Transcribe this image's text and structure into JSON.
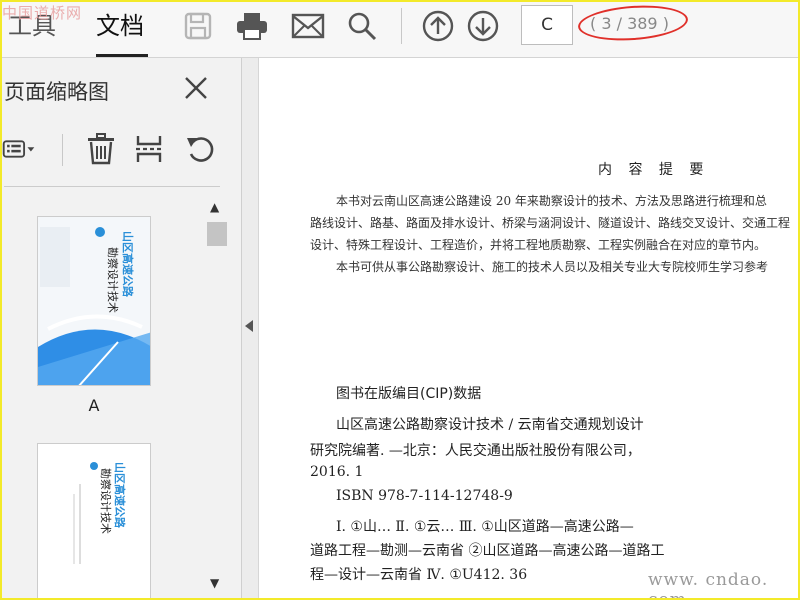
{
  "watermark": "中国道桥网",
  "toolbar": {
    "tabs": [
      "工具",
      "文档"
    ],
    "active_tab": "文档",
    "current_page": "C",
    "page_count": "( 3 / 389 )"
  },
  "sidebar": {
    "title": "页面缩略图",
    "thumbnails": [
      {
        "label": "A",
        "cover_title": "山区高速公路",
        "cover_subtitle": "勘察设计技术"
      },
      {
        "label": "",
        "cover_title": "山区高速公路",
        "cover_subtitle": "勘察设计技术"
      }
    ]
  },
  "document": {
    "summary_heading": "内  容  提  要",
    "summary_lines": [
      "本书对云南山区高速公路建设 20 年来勘察设计的技术、方法及思路进行梳理和总",
      "路线设计、路基、路面及排水设计、桥梁与涵洞设计、隧道设计、路线交叉设计、交通工程",
      "设计、特殊工程设计、工程造价，并将工程地质勘察、工程实例融合在对应的章节内。",
      "本书可供从事公路勘察设计、施工的技术人员以及相关专业大专院校师生学习参考"
    ],
    "cip_heading": "图书在版编目(CIP)数据",
    "cip_lines": [
      "山区高速公路勘察设计技术 / 云南省交通规划设计",
      "研究院编著. —北京：人民交通出版社股份有限公司，",
      "2016. 1",
      "ISBN 978-7-114-12748-9",
      "Ⅰ. ①山…   Ⅱ. ①云…   Ⅲ. ①山区道路—高速公路—",
      "道路工程—勘测—云南省 ②山区道路—高速公路—道路工",
      "程—设计—云南省   Ⅳ. ①U412. 36"
    ]
  },
  "footer_watermark": "www. cndao. com",
  "colors": {
    "frame": "#f3ea2a",
    "highlight_ring": "#e0302a",
    "cover_blue": "#2a8fd8"
  }
}
